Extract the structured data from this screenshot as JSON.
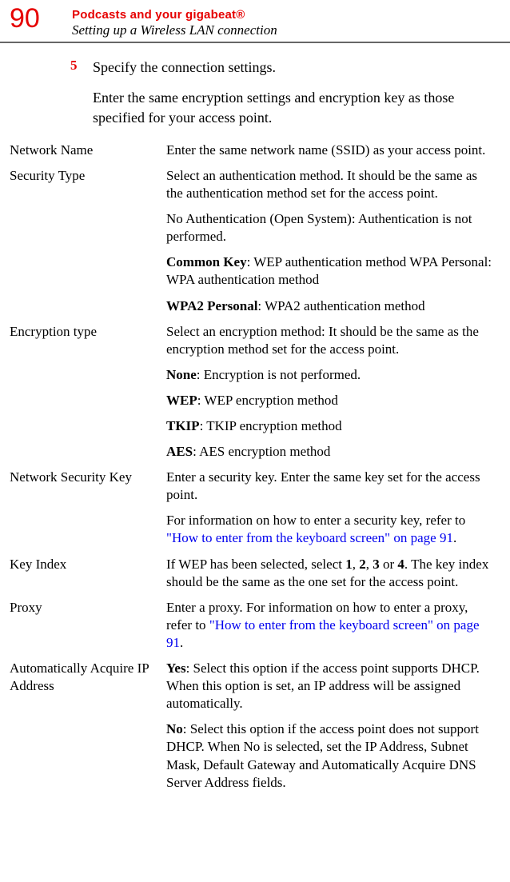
{
  "page_number": "90",
  "header": {
    "title": "Podcasts and your gigabeat®",
    "subtitle": "Setting up a Wireless LAN connection"
  },
  "step": {
    "number": "5",
    "text": "Specify the connection settings.",
    "paragraph": "Enter the same encryption settings and encryption key as those specified for your access point."
  },
  "settings": {
    "network_name": {
      "label": "Network Name",
      "p1": "Enter the same network name (SSID) as your access point."
    },
    "security_type": {
      "label": "Security Type",
      "p1": "Select an authentication method. It should be the same as the authentication method set for the access point.",
      "p2a": "No Authentication (Open System)",
      "p2b": ": Authentication is not performed.",
      "p3a": "Common Key",
      "p3b": ": WEP authentication method WPA Personal: WPA authentication method",
      "p4a": "WPA2 Personal",
      "p4b": ": WPA2 authentication method"
    },
    "encryption_type": {
      "label": "Encryption type",
      "p1": "Select an encryption method: It should be the same as the encryption method set for the access point.",
      "p2a": "None",
      "p2b": ": Encryption is not performed.",
      "p3a": "WEP",
      "p3b": ": WEP encryption method",
      "p4a": "TKIP",
      "p4b": ": TKIP encryption method",
      "p5a": "AES",
      "p5b": ": AES encryption method"
    },
    "security_key": {
      "label": "Network Security Key",
      "p1": "Enter a security key. Enter the same key set for the access point.",
      "p2a": "For information on how to enter a security key, refer to ",
      "p2b": "\"How to enter from the keyboard screen\" on page 91",
      "p2c": "."
    },
    "key_index": {
      "label": "Key Index",
      "p1a": "If WEP has been selected, select ",
      "p1b": "1",
      "p1c": ", ",
      "p1d": "2",
      "p1e": ", ",
      "p1f": "3",
      "p1g": " or ",
      "p1h": "4",
      "p1i": ". The key index should be the same as the one set for the access point."
    },
    "proxy": {
      "label": "Proxy",
      "p1a": "Enter a proxy. For information on how to enter a proxy, refer to ",
      "p1b": "\"How to enter from the keyboard screen\" on page 91",
      "p1c": "."
    },
    "auto_ip": {
      "label": "Automatically Acquire IP Address",
      "p1a": "Yes",
      "p1b": ": Select this option if the access point supports DHCP. When this option is set, an IP address will be assigned automatically.",
      "p2a": "No",
      "p2b": ": Select this option if the access point does not support DHCP. When No is selected, set the IP Address, Subnet Mask, Default Gateway and Automatically Acquire DNS Server Address fields."
    }
  }
}
